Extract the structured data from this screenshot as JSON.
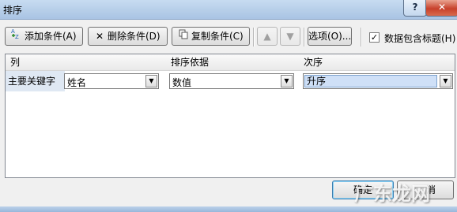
{
  "window": {
    "title": "排序",
    "help_label": "?",
    "close_label": "✕"
  },
  "toolbar": {
    "add_label": "添加条件(A)",
    "delete_label": "删除条件(D)",
    "copy_label": "复制条件(C)",
    "move_up_label": "▲",
    "move_down_label": "▼",
    "options_label": "选项(O)...",
    "header_checkbox_label": "数据包含标题(H)",
    "header_checkbox_checked": true
  },
  "grid": {
    "columns": [
      "列",
      "排序依据",
      "次序"
    ],
    "rows": [
      {
        "label": "主要关键字",
        "column": "姓名",
        "sort_on": "数值",
        "order": "升序"
      }
    ]
  },
  "footer": {
    "ok_label": "确定",
    "cancel_label": "消"
  },
  "watermark": "广东龙网",
  "colors": {
    "title_bar": "#b5cde8",
    "close_button": "#c7412b",
    "selection": "#cfe0f7"
  }
}
